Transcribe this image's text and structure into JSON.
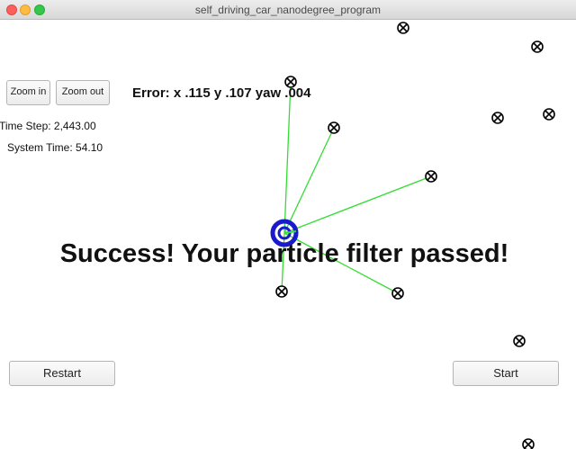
{
  "window": {
    "title": "self_driving_car_nanodegree_program"
  },
  "toolbar": {
    "zoom_in_label": "Zoom in",
    "zoom_out_label": "Zoom out"
  },
  "status": {
    "error_text": "Error: x .115 y .107 yaw .004",
    "time_step": "Time Step: 2,443.00",
    "system_time": "System Time: 54.10"
  },
  "banner": {
    "message": "Success! Your particle filter passed!"
  },
  "controls": {
    "restart_label": "Restart",
    "start_label": "Start"
  },
  "colors": {
    "observation_line": "#33dd33",
    "vehicle": "#1a1acc",
    "landmark": "#000000"
  }
}
